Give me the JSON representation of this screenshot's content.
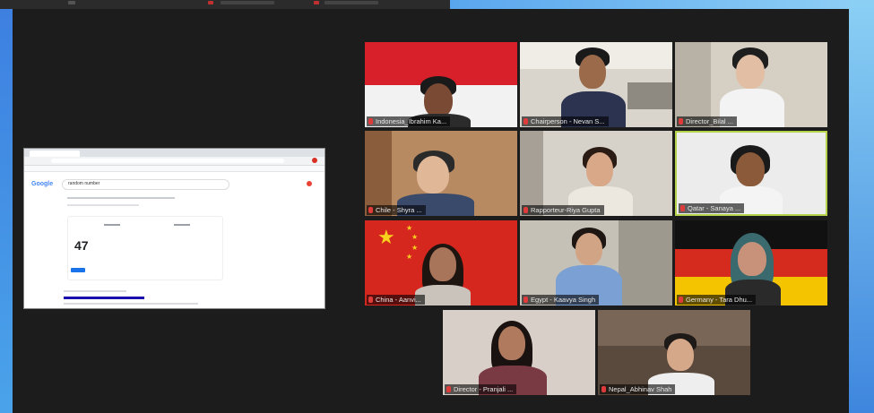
{
  "share": {
    "search_query": "random number",
    "result_number": "47",
    "google_label": "Google"
  },
  "participants": [
    {
      "name": "Indonesia_Ibrahim Ka...",
      "bg": "flag-indonesia"
    },
    {
      "name": "Chairperson - Nevan S...",
      "bg": "office"
    },
    {
      "name": "Director_Bilal ...",
      "bg": "room"
    },
    {
      "name": "Chile - Shyra ...",
      "bg": "room"
    },
    {
      "name": "Rapporteur-Riya Gupta",
      "bg": "room"
    },
    {
      "name": "Qatar - Sanaya ...",
      "bg": "room",
      "active": true
    },
    {
      "name": "China - Aanvi...",
      "bg": "flag-china"
    },
    {
      "name": "Egypt - Kaavya Singh",
      "bg": "room"
    },
    {
      "name": "Germany - Tara Dhu...",
      "bg": "flag-germany"
    },
    {
      "name": "Director - Pranjali ...",
      "bg": "room"
    },
    {
      "name": "Nepal_Abhinav Shah",
      "bg": "room"
    }
  ],
  "colors": {
    "stage_bg": "#1c1c1c",
    "active_border": "#b4d24a",
    "mic_muted": "#e03b3b"
  }
}
